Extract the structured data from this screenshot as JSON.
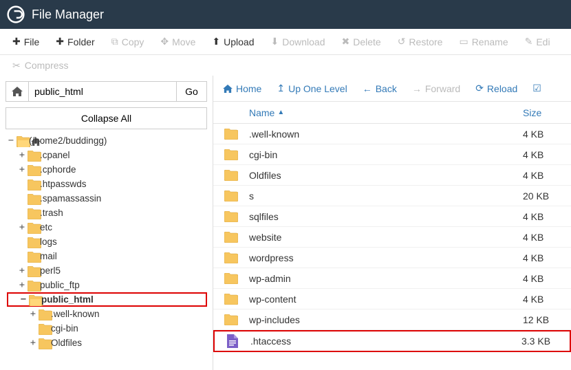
{
  "header": {
    "title": "File Manager"
  },
  "toolbar": {
    "file": "File",
    "folder": "Folder",
    "copy": "Copy",
    "move": "Move",
    "upload": "Upload",
    "download": "Download",
    "delete": "Delete",
    "restore": "Restore",
    "rename": "Rename",
    "edit": "Edi"
  },
  "toolbar2": {
    "compress": "Compress"
  },
  "left": {
    "path": "public_html",
    "go": "Go",
    "collapse": "Collapse All",
    "tree": [
      {
        "level": 0,
        "toggle": "−",
        "icon": "home-folder",
        "label": "(/home2/buddingg)",
        "highlight": false
      },
      {
        "level": 1,
        "toggle": "+",
        "icon": "folder",
        "label": ".cpanel",
        "highlight": false
      },
      {
        "level": 1,
        "toggle": "+",
        "icon": "folder",
        "label": ".cphorde",
        "highlight": false
      },
      {
        "level": 1,
        "toggle": "",
        "icon": "folder",
        "label": ".htpasswds",
        "highlight": false
      },
      {
        "level": 1,
        "toggle": "",
        "icon": "folder",
        "label": ".spamassassin",
        "highlight": false
      },
      {
        "level": 1,
        "toggle": "",
        "icon": "folder",
        "label": ".trash",
        "highlight": false
      },
      {
        "level": 1,
        "toggle": "+",
        "icon": "folder",
        "label": "etc",
        "highlight": false
      },
      {
        "level": 1,
        "toggle": "",
        "icon": "folder",
        "label": "logs",
        "highlight": false
      },
      {
        "level": 1,
        "toggle": "",
        "icon": "folder",
        "label": "mail",
        "highlight": false
      },
      {
        "level": 1,
        "toggle": "+",
        "icon": "folder",
        "label": "perl5",
        "highlight": false
      },
      {
        "level": 1,
        "toggle": "+",
        "icon": "folder",
        "label": "public_ftp",
        "highlight": false
      },
      {
        "level": 1,
        "toggle": "−",
        "icon": "folder-open",
        "label": "public_html",
        "highlight": true
      },
      {
        "level": 2,
        "toggle": "+",
        "icon": "folder",
        "label": ".well-known",
        "highlight": false
      },
      {
        "level": 2,
        "toggle": "",
        "icon": "folder",
        "label": "cgi-bin",
        "highlight": false
      },
      {
        "level": 2,
        "toggle": "+",
        "icon": "folder",
        "label": "Oldfiles",
        "highlight": false
      }
    ]
  },
  "right": {
    "toolbar": {
      "home": "Home",
      "up": "Up One Level",
      "back": "Back",
      "forward": "Forward",
      "reload": "Reload"
    },
    "columns": {
      "name": "Name",
      "size": "Size"
    },
    "rows": [
      {
        "type": "folder",
        "name": ".well-known",
        "size": "4 KB",
        "highlight": false
      },
      {
        "type": "folder",
        "name": "cgi-bin",
        "size": "4 KB",
        "highlight": false
      },
      {
        "type": "folder",
        "name": "Oldfiles",
        "size": "4 KB",
        "highlight": false
      },
      {
        "type": "folder",
        "name": "s",
        "size": "20 KB",
        "highlight": false
      },
      {
        "type": "folder",
        "name": "sqlfiles",
        "size": "4 KB",
        "highlight": false
      },
      {
        "type": "folder",
        "name": "website",
        "size": "4 KB",
        "highlight": false
      },
      {
        "type": "folder",
        "name": "wordpress",
        "size": "4 KB",
        "highlight": false
      },
      {
        "type": "folder",
        "name": "wp-admin",
        "size": "4 KB",
        "highlight": false
      },
      {
        "type": "folder",
        "name": "wp-content",
        "size": "4 KB",
        "highlight": false
      },
      {
        "type": "folder",
        "name": "wp-includes",
        "size": "12 KB",
        "highlight": false
      },
      {
        "type": "file",
        "name": ".htaccess",
        "size": "3.3 KB",
        "highlight": true
      }
    ]
  }
}
